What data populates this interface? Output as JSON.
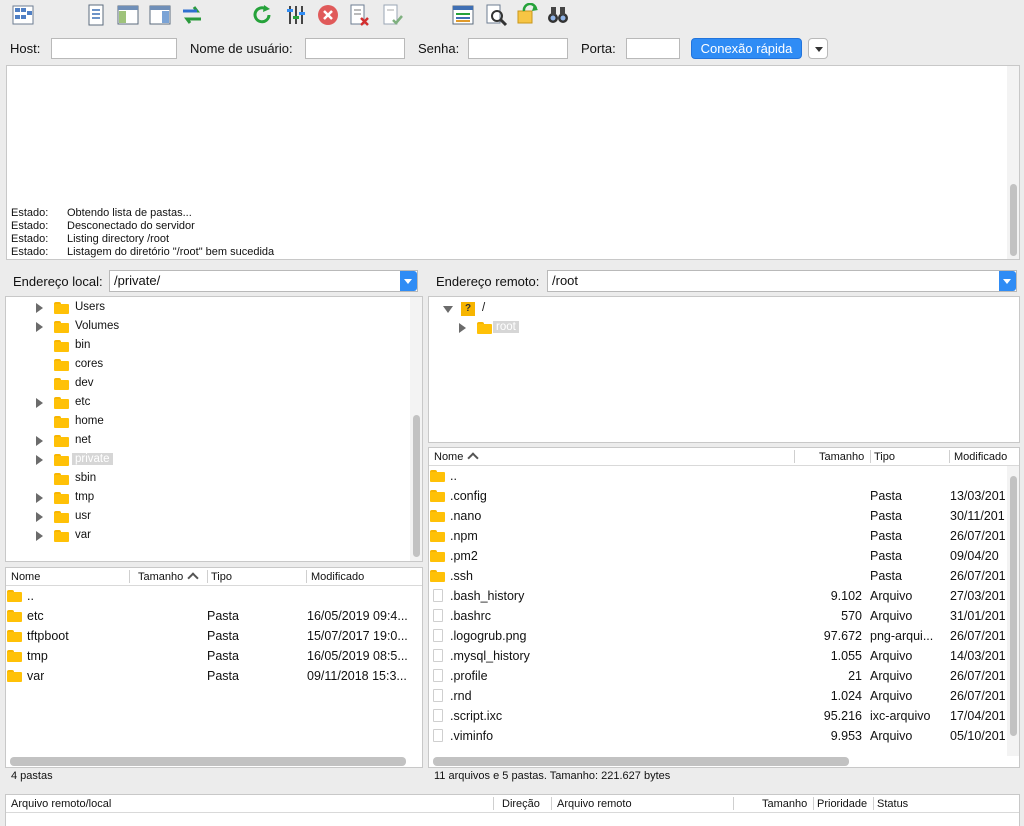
{
  "toolbar": {
    "icons": [
      "site-manager-icon",
      "message-log-icon",
      "local-tree-icon",
      "remote-tree-icon",
      "transfer-queue-icon",
      "refresh-icon",
      "process-queue-icon",
      "cancel-icon",
      "disconnect-icon",
      "reconnect-icon",
      "directory-listing-filter-icon",
      "compare-icon",
      "sync-browse-icon",
      "search-icon"
    ]
  },
  "quickconnect": {
    "host_label": "Host:",
    "user_label": "Nome de usuário:",
    "pass_label": "Senha:",
    "port_label": "Porta:",
    "button_label": "Conexão rápida",
    "host_value": "",
    "user_value": "",
    "pass_value": "",
    "port_value": ""
  },
  "log": {
    "lines": [
      {
        "status": "Estado:",
        "text": "Obtendo lista de pastas..."
      },
      {
        "status": "Estado:",
        "text": "Desconectado do servidor"
      },
      {
        "status": "Estado:",
        "text": "Listing directory /root"
      },
      {
        "status": "Estado:",
        "text": "Listagem do diretório \"/root\" bem sucedida"
      }
    ]
  },
  "local": {
    "address_label": "Endereço local:",
    "address_value": "/private/",
    "tree": [
      {
        "label": "Users",
        "expandable": true
      },
      {
        "label": "Volumes",
        "expandable": true
      },
      {
        "label": "bin",
        "expandable": false
      },
      {
        "label": "cores",
        "expandable": false
      },
      {
        "label": "dev",
        "expandable": false
      },
      {
        "label": "etc",
        "expandable": true
      },
      {
        "label": "home",
        "expandable": false
      },
      {
        "label": "net",
        "expandable": true
      },
      {
        "label": "private",
        "expandable": true
      },
      {
        "label": "sbin",
        "expandable": false
      },
      {
        "label": "tmp",
        "expandable": true
      },
      {
        "label": "usr",
        "expandable": true
      },
      {
        "label": "var",
        "expandable": true
      }
    ],
    "headers": {
      "name": "Nome",
      "size": "Tamanho",
      "type": "Tipo",
      "modified": "Modificado"
    },
    "files": [
      {
        "name": "..",
        "size": "",
        "type": "",
        "modified": ""
      },
      {
        "name": "etc",
        "size": "",
        "type": "Pasta",
        "modified": "16/05/2019 09:4..."
      },
      {
        "name": "tftpboot",
        "size": "",
        "type": "Pasta",
        "modified": "15/07/2017 19:0..."
      },
      {
        "name": "tmp",
        "size": "",
        "type": "Pasta",
        "modified": "16/05/2019 08:5..."
      },
      {
        "name": "var",
        "size": "",
        "type": "Pasta",
        "modified": "09/11/2018 15:3..."
      }
    ],
    "status": "4 pastas"
  },
  "remote": {
    "address_label": "Endereço remoto:",
    "address_value": "/root",
    "tree": [
      {
        "label": "/",
        "expanded": true
      },
      {
        "label": "root",
        "expanded": false
      }
    ],
    "headers": {
      "name": "Nome",
      "size": "Tamanho",
      "type": "Tipo",
      "modified": "Modificado"
    },
    "files": [
      {
        "name": "..",
        "size": "",
        "type": "",
        "modified": "",
        "folder": true
      },
      {
        "name": ".config",
        "size": "",
        "type": "Pasta",
        "modified": "13/03/201",
        "folder": true
      },
      {
        "name": ".nano",
        "size": "",
        "type": "Pasta",
        "modified": "30/11/201",
        "folder": true
      },
      {
        "name": ".npm",
        "size": "",
        "type": "Pasta",
        "modified": "26/07/201",
        "folder": true
      },
      {
        "name": ".pm2",
        "size": "",
        "type": "Pasta",
        "modified": "09/04/20",
        "folder": true
      },
      {
        "name": ".ssh",
        "size": "",
        "type": "Pasta",
        "modified": "26/07/201",
        "folder": true
      },
      {
        "name": ".bash_history",
        "size": "9.102",
        "type": "Arquivo",
        "modified": "27/03/201",
        "folder": false
      },
      {
        "name": ".bashrc",
        "size": "570",
        "type": "Arquivo",
        "modified": "31/01/201",
        "folder": false
      },
      {
        "name": ".logogrub.png",
        "size": "97.672",
        "type": "png-arqui...",
        "modified": "26/07/201",
        "folder": false
      },
      {
        "name": ".mysql_history",
        "size": "1.055",
        "type": "Arquivo",
        "modified": "14/03/201",
        "folder": false
      },
      {
        "name": ".profile",
        "size": "21",
        "type": "Arquivo",
        "modified": "26/07/201",
        "folder": false
      },
      {
        "name": ".rnd",
        "size": "1.024",
        "type": "Arquivo",
        "modified": "26/07/201",
        "folder": false
      },
      {
        "name": ".script.ixc",
        "size": "95.216",
        "type": "ixc-arquivo",
        "modified": "17/04/201",
        "folder": false
      },
      {
        "name": ".viminfo",
        "size": "9.953",
        "type": "Arquivo",
        "modified": "05/10/201",
        "folder": false
      }
    ],
    "status": "11 arquivos e 5 pastas. Tamanho: 221.627 bytes"
  },
  "queue": {
    "col_file": "Arquivo remoto/local",
    "col_direction": "Direção",
    "col_remote": "Arquivo remoto",
    "col_size": "Tamanho",
    "col_priority": "Prioridade",
    "col_status": "Status"
  },
  "colors": {
    "accent": "#2f8cf5",
    "folder": "#ffc107"
  }
}
